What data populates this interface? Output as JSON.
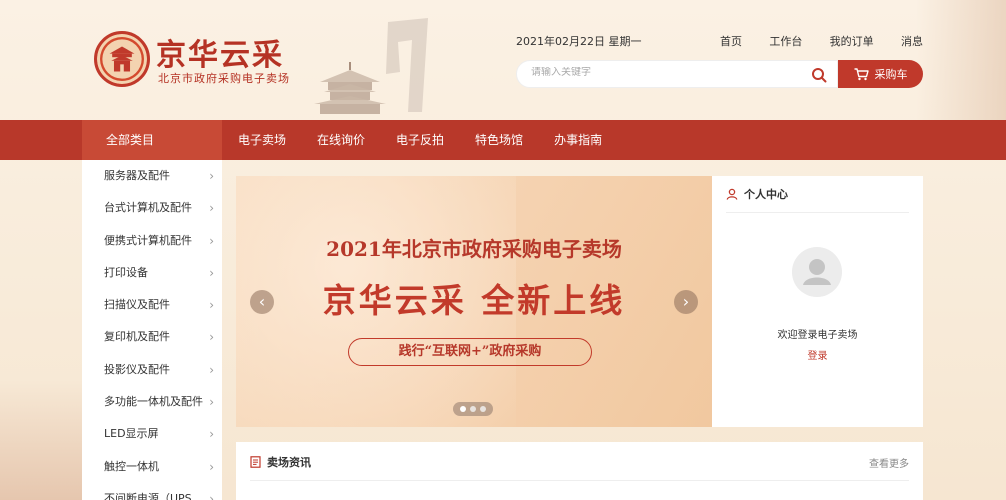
{
  "brand": {
    "title": "京华云采",
    "subtitle": "北京市政府采购电子卖场",
    "seal_text": "CIRCLE"
  },
  "header": {
    "date": "2021年02月22日 星期一",
    "links": [
      "首页",
      "工作台",
      "我的订单",
      "消息"
    ],
    "search_placeholder": "请输入关键字",
    "cart_label": "采购车"
  },
  "nav": {
    "all_categories": "全部类目",
    "items": [
      "电子卖场",
      "在线询价",
      "电子反拍",
      "特色场馆",
      "办事指南"
    ]
  },
  "sidebar": {
    "items": [
      "服务器及配件",
      "台式计算机及配件",
      "便携式计算机配件",
      "打印设备",
      "扫描仪及配件",
      "复印机及配件",
      "投影仪及配件",
      "多功能一体机及配件",
      "LED显示屏",
      "触控一体机",
      "不间断电源（UPS"
    ]
  },
  "banner": {
    "line1": "2021年北京市政府采购电子卖场",
    "line2": "京华云采  全新上线",
    "pill": "践行“互联网+”政府采购",
    "slide_count": 3,
    "active_slide": 1
  },
  "personal": {
    "title": "个人中心",
    "welcome": "欢迎登录电子卖场",
    "login": "登录"
  },
  "news": {
    "title": "卖场资讯",
    "more": "查看更多"
  },
  "colors": {
    "brand_red": "#b8382a",
    "accent_red": "#c0392b",
    "background": "#fbf1e4"
  }
}
